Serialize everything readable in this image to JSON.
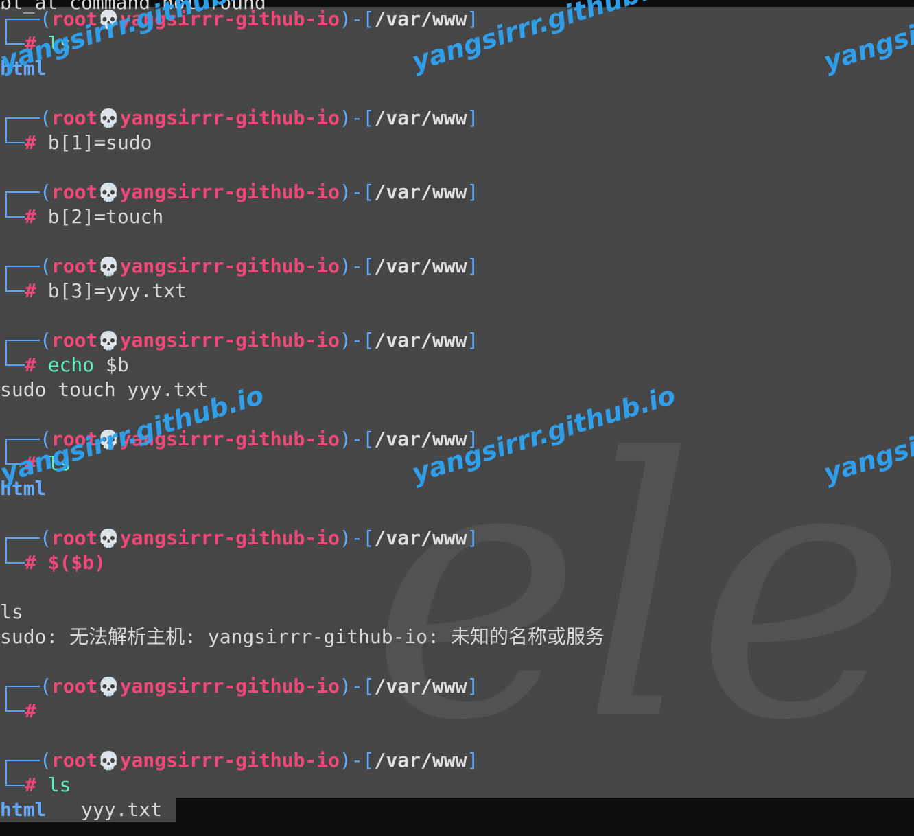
{
  "prompt": {
    "user": "root",
    "host": "yangsirrr-github-io",
    "path": "/var/www",
    "skull": "💀",
    "hash": "#"
  },
  "top_partial_line": "bt_at command not found",
  "entries": [
    {
      "cmd": "ls",
      "args": "",
      "output": [
        "html"
      ]
    },
    {
      "cmd": "",
      "args": "b[1]=sudo",
      "output": []
    },
    {
      "cmd": "",
      "args": "b[2]=touch",
      "output": []
    },
    {
      "cmd": "",
      "args": "b[3]=yyy.txt",
      "output": []
    },
    {
      "cmd": "echo",
      "args": " $b",
      "output": [
        "sudo touch yyy.txt"
      ]
    },
    {
      "cmd": "ls",
      "args": "",
      "output": [
        "html"
      ]
    },
    {
      "cmd": "$($b)",
      "args": "",
      "output": [
        "",
        "ls",
        "sudo: 无法解析主机: yangsirrr-github-io: 未知的名称或服务"
      ]
    },
    {
      "cmd": "",
      "args": "",
      "output": []
    },
    {
      "cmd": "ls",
      "args": "",
      "output": []
    }
  ],
  "last_output": {
    "dir": "html",
    "file": "yyy.txt"
  },
  "watermark": {
    "text": "yangsirrr.github.io",
    "text_cut": "yangsir",
    "color": "#2fa3f2"
  },
  "background_logo": "ele",
  "colors": {
    "background": "#464646",
    "prompt_frame": "#58a6ff",
    "user_host": "#f2477a",
    "command": "#5ff0c0",
    "directory": "#62aaff"
  }
}
